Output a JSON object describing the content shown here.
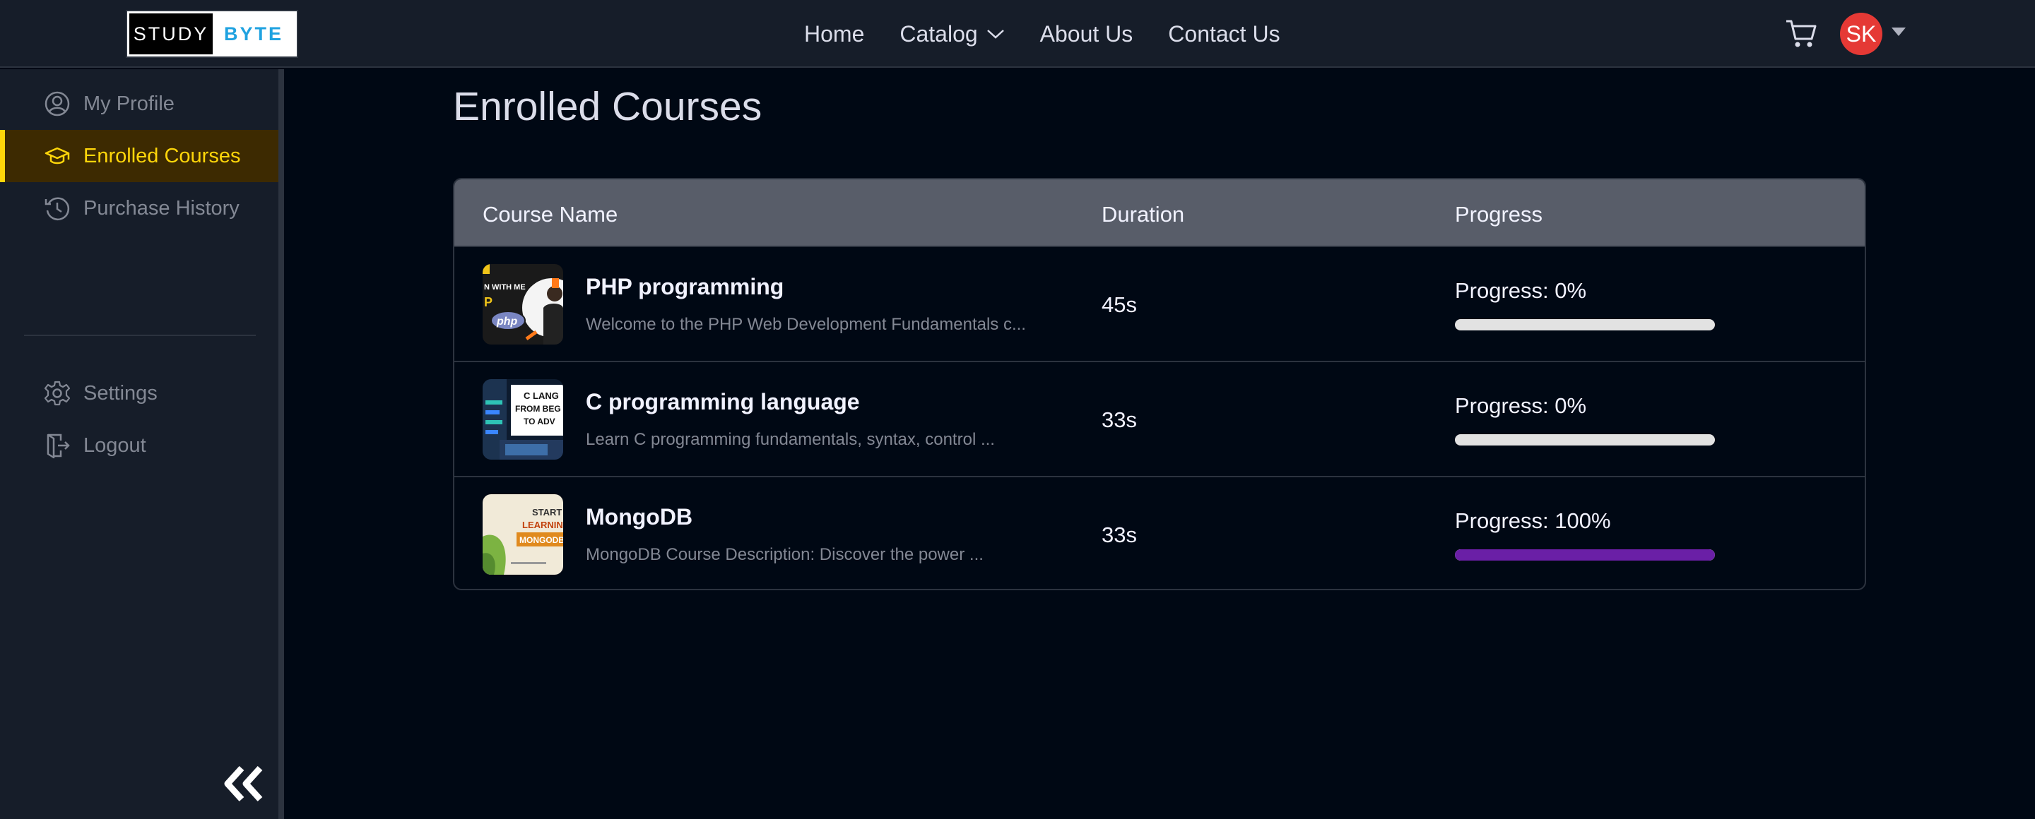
{
  "logo": {
    "left": "STUDY",
    "right": "BYTE"
  },
  "nav": {
    "links": [
      "Home",
      "Catalog",
      "About Us",
      "Contact Us"
    ]
  },
  "user": {
    "initials": "SK"
  },
  "sidebar": {
    "items": [
      {
        "label": "My Profile",
        "icon": "user-circle-icon"
      },
      {
        "label": "Enrolled Courses",
        "icon": "graduation-cap-icon",
        "active": true
      },
      {
        "label": "Purchase History",
        "icon": "history-icon"
      },
      {
        "label": "Settings",
        "icon": "gear-icon"
      },
      {
        "label": "Logout",
        "icon": "logout-icon"
      }
    ],
    "collapse_icon": "double-chevron-left-icon"
  },
  "main": {
    "title": "Enrolled Courses",
    "table": {
      "headers": {
        "name": "Course Name",
        "duration": "Duration",
        "progress": "Progress"
      },
      "rows": [
        {
          "title": "PHP programming",
          "description": "Welcome to the PHP Web Development Fundamentals c...",
          "duration": "45s",
          "progress_label": "Progress: 0%",
          "progress": 0,
          "thumb_text": "N WITH ME"
        },
        {
          "title": "C programming language",
          "description": "Learn C programming fundamentals, syntax, control ...",
          "duration": "33s",
          "progress_label": "Progress: 0%",
          "progress": 0,
          "thumb_text": "C LANG FROM BEG TO ADV"
        },
        {
          "title": "MongoDB",
          "description": "MongoDB Course Description: Discover the power ...",
          "duration": "33s",
          "progress_label": "Progress: 100%",
          "progress": 100,
          "thumb_text": "START LEARNIN MONGODB"
        }
      ]
    }
  },
  "colors": {
    "accent": "#ffd60a",
    "progress_fill": "#6a1fa6",
    "avatar": "#e53935"
  }
}
